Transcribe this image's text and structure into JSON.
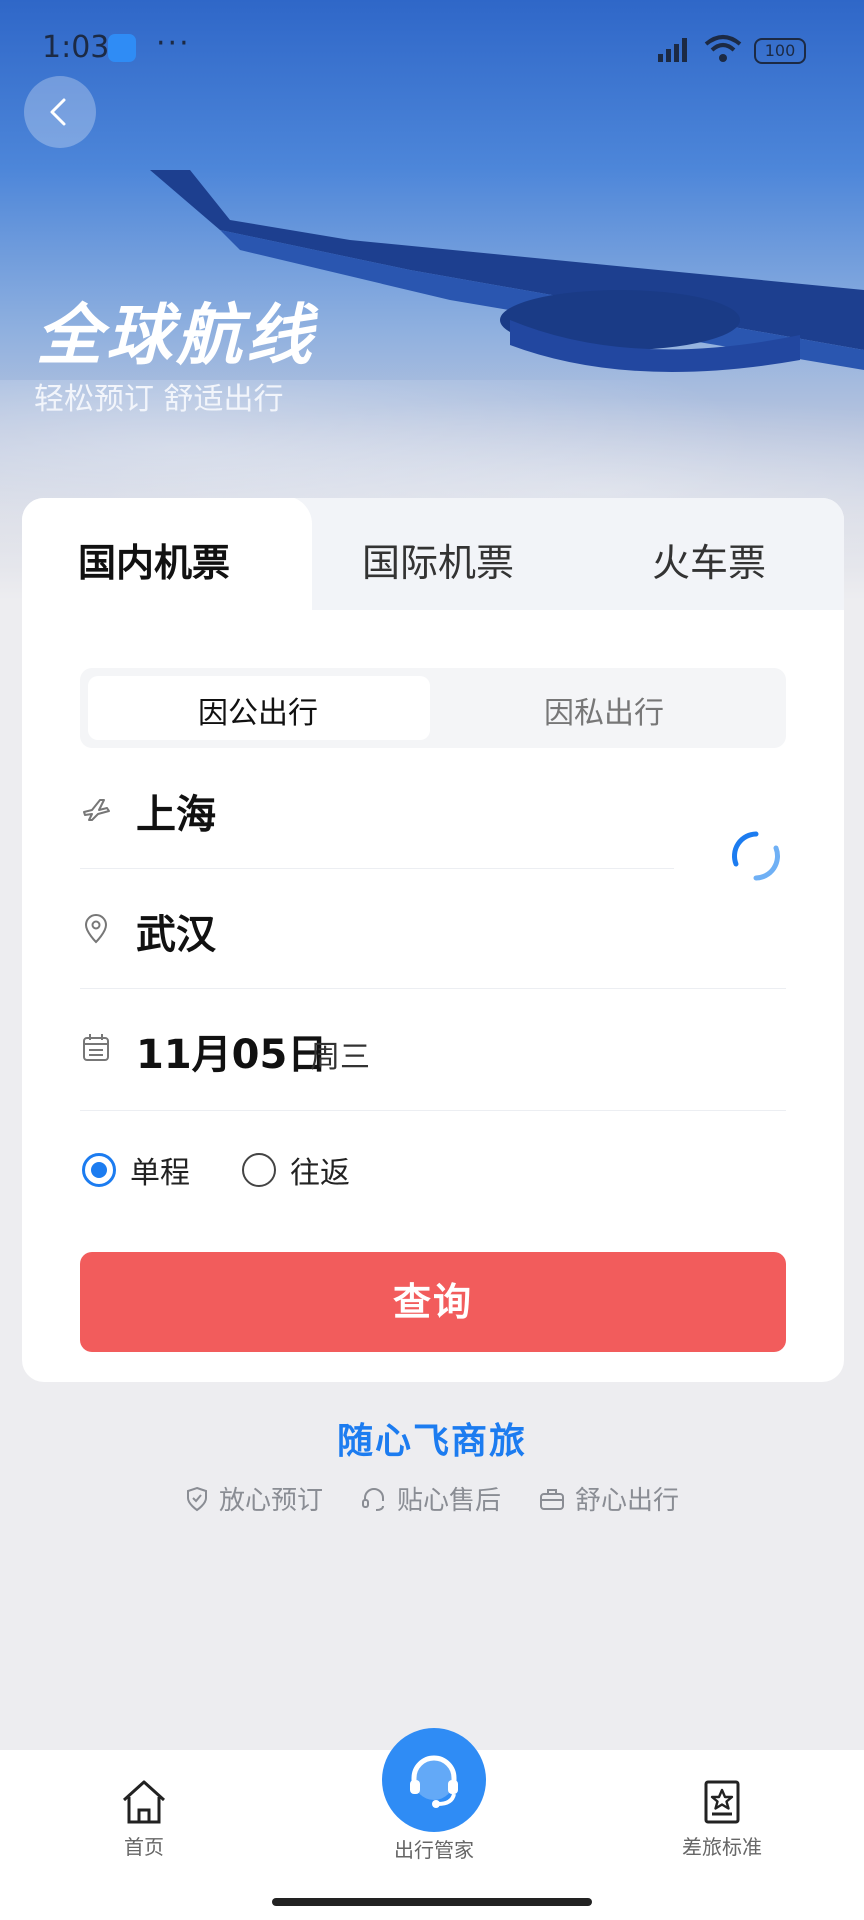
{
  "status_bar": {
    "time": "1:03",
    "battery": "100"
  },
  "hero": {
    "title": "全球航线",
    "subtitle": "轻松预订 舒适出行"
  },
  "tabs": [
    {
      "label": "国内机票",
      "active": true
    },
    {
      "label": "国际机票",
      "active": false
    },
    {
      "label": "火车票",
      "active": false
    }
  ],
  "segment": [
    {
      "label": "因公出行",
      "active": true
    },
    {
      "label": "因私出行",
      "active": false
    }
  ],
  "form": {
    "from_city": "上海",
    "to_city": "武汉",
    "date": "11月05日",
    "weekday": "周三",
    "trip_types": [
      {
        "label": "单程",
        "selected": true
      },
      {
        "label": "往返",
        "selected": false
      }
    ],
    "search_label": "查询"
  },
  "brand": {
    "name": "随心飞商旅",
    "features": [
      "放心预订",
      "贴心售后",
      "舒心出行"
    ]
  },
  "bottom_nav": [
    {
      "label": "首页",
      "icon": "home-icon"
    },
    {
      "label": "出行管家",
      "icon": "headset-icon"
    },
    {
      "label": "差旅标准",
      "icon": "star-book-icon"
    }
  ],
  "colors": {
    "accent": "#1c7cf0",
    "search_button": "#f25c5c",
    "center_nav": "#2f8cf5"
  }
}
